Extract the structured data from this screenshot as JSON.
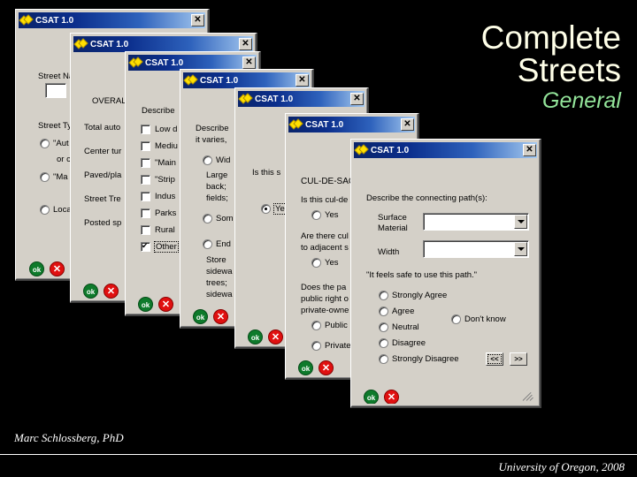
{
  "slide": {
    "title_line1": "Complete",
    "title_line2": "Streets",
    "subtitle": "General",
    "author": "Marc Schlossberg, PhD",
    "organization": "University of Oregon, 2008",
    "background_color": "#000000",
    "title_color": "#FFFFE8",
    "subtitle_color": "#93E49A"
  },
  "common": {
    "window_title": "CSAT 1.0",
    "close_label": "✕",
    "ok_label": "ok",
    "cancel_label": "✕",
    "dialog_face_color": "#D4D0C8",
    "titlebar_start_color": "#0A246A",
    "titlebar_end_color": "#A6CAF0"
  },
  "windows": [
    {
      "id": "win-street-info",
      "labels": [
        "Street Na",
        "Street Ty",
        "or c"
      ],
      "radios": [
        {
          "label": "\"Aut",
          "checked": false
        },
        {
          "label": "\"Ma",
          "checked": false
        },
        {
          "label": "Loca",
          "checked": false
        }
      ],
      "textbox_value": ""
    },
    {
      "id": "win-overall",
      "labels": [
        "OVERALL",
        "Total auto",
        "Center tur",
        "Paved/pla",
        "Street Tre",
        "Posted sp"
      ]
    },
    {
      "id": "win-describe-area",
      "prompt": "Describe",
      "checkboxes": [
        {
          "label": "Low d",
          "checked": false,
          "focused": false
        },
        {
          "label": "Mediu",
          "checked": false,
          "focused": false
        },
        {
          "label": "\"Main",
          "checked": false,
          "focused": false
        },
        {
          "label": "\"Strip",
          "checked": false,
          "focused": false
        },
        {
          "label": "Indus",
          "checked": false,
          "focused": false
        },
        {
          "label": "Parks",
          "checked": false,
          "focused": false
        },
        {
          "label": "Rural",
          "checked": false,
          "focused": false
        },
        {
          "label": "Other",
          "checked": true,
          "focused": true
        }
      ]
    },
    {
      "id": "win-describe-varies",
      "prompt_line1": "Describe",
      "prompt_line2": "it varies,",
      "radios": [
        {
          "label": "Wid",
          "checked": false
        },
        {
          "label": "Som",
          "checked": false
        },
        {
          "label": "End",
          "checked": false
        }
      ],
      "notes_a": [
        "Large",
        "back;",
        "fields;"
      ],
      "notes_b": [
        "Store",
        "sidewa",
        "trees;",
        "sidewa"
      ]
    },
    {
      "id": "win-is-this",
      "prompt": "Is this s",
      "radios": [
        {
          "label": "Ye",
          "checked": true,
          "focused": true
        }
      ]
    },
    {
      "id": "win-cul-de-sac",
      "heading": "CUL-DE-SAC",
      "q1": "Is this cul-de",
      "q1_radios": [
        {
          "label": "Yes",
          "checked": false
        }
      ],
      "q2_line1": "Are there cul",
      "q2_line2": "to adjacent s",
      "q2_radios": [
        {
          "label": "Yes",
          "checked": false
        }
      ],
      "q3_line1": "Does the pa",
      "q3_line2": "public right o",
      "q3_line3": "private-owne",
      "q3_radios": [
        {
          "label": "Public r",
          "checked": false
        },
        {
          "label": "Private-",
          "checked": false
        }
      ]
    },
    {
      "id": "win-connecting-path",
      "prompt": "Describe the connecting path(s):",
      "fields": [
        {
          "label_line1": "Surface",
          "label_line2": "Material",
          "value": ""
        },
        {
          "label_line1": "Width",
          "label_line2": "",
          "value": ""
        }
      ],
      "statement": "\"It feels safe to use this path.\"",
      "scale": [
        {
          "label": "Strongly Agree",
          "checked": false
        },
        {
          "label": "Agree",
          "checked": false
        },
        {
          "label": "Neutral",
          "checked": false
        },
        {
          "label": "Disagree",
          "checked": false
        },
        {
          "label": "Strongly Disagree",
          "checked": false
        }
      ],
      "dont_know": {
        "label": "Don't know",
        "checked": false
      },
      "nav_prev": "<<",
      "nav_next": ">>"
    }
  ]
}
